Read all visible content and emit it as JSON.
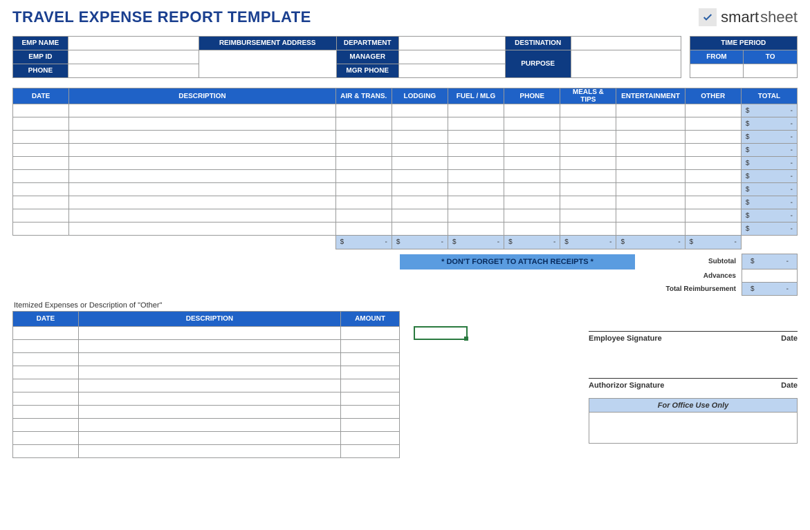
{
  "title": "TRAVEL EXPENSE REPORT TEMPLATE",
  "brand": {
    "name1": "smart",
    "name2": "sheet"
  },
  "info": {
    "emp_name_label": "EMP NAME",
    "emp_id_label": "EMP ID",
    "phone_label": "PHONE",
    "reimb_label": "REIMBURSEMENT ADDRESS",
    "dept_label": "DEPARTMENT",
    "mgr_label": "MANAGER",
    "mgrphone_label": "MGR PHONE",
    "dest_label": "DESTINATION",
    "purpose_label": "PURPOSE",
    "period_label": "TIME PERIOD",
    "from_label": "FROM",
    "to_label": "TO",
    "emp_name": "",
    "emp_id": "",
    "phone": "",
    "reimb": "",
    "dept": "",
    "mgr": "",
    "mgrphone": "",
    "dest": "",
    "purpose": "",
    "from": "",
    "to": ""
  },
  "expense_headers": {
    "date": "DATE",
    "desc": "DESCRIPTION",
    "air": "AIR & TRANS.",
    "lodg": "LODGING",
    "fuel": "FUEL / MLG",
    "ph": "PHONE",
    "meals": "MEALS & TIPS",
    "ent": "ENTERTAINMENT",
    "other": "OTHER",
    "total": "TOTAL"
  },
  "expense_rows": [
    {
      "date": "",
      "desc": "",
      "air": "",
      "lodg": "",
      "fuel": "",
      "ph": "",
      "meals": "",
      "ent": "",
      "other": "",
      "total_d": "$",
      "total_v": "-"
    },
    {
      "date": "",
      "desc": "",
      "air": "",
      "lodg": "",
      "fuel": "",
      "ph": "",
      "meals": "",
      "ent": "",
      "other": "",
      "total_d": "$",
      "total_v": "-"
    },
    {
      "date": "",
      "desc": "",
      "air": "",
      "lodg": "",
      "fuel": "",
      "ph": "",
      "meals": "",
      "ent": "",
      "other": "",
      "total_d": "$",
      "total_v": "-"
    },
    {
      "date": "",
      "desc": "",
      "air": "",
      "lodg": "",
      "fuel": "",
      "ph": "",
      "meals": "",
      "ent": "",
      "other": "",
      "total_d": "$",
      "total_v": "-"
    },
    {
      "date": "",
      "desc": "",
      "air": "",
      "lodg": "",
      "fuel": "",
      "ph": "",
      "meals": "",
      "ent": "",
      "other": "",
      "total_d": "$",
      "total_v": "-"
    },
    {
      "date": "",
      "desc": "",
      "air": "",
      "lodg": "",
      "fuel": "",
      "ph": "",
      "meals": "",
      "ent": "",
      "other": "",
      "total_d": "$",
      "total_v": "-"
    },
    {
      "date": "",
      "desc": "",
      "air": "",
      "lodg": "",
      "fuel": "",
      "ph": "",
      "meals": "",
      "ent": "",
      "other": "",
      "total_d": "$",
      "total_v": "-"
    },
    {
      "date": "",
      "desc": "",
      "air": "",
      "lodg": "",
      "fuel": "",
      "ph": "",
      "meals": "",
      "ent": "",
      "other": "",
      "total_d": "$",
      "total_v": "-"
    },
    {
      "date": "",
      "desc": "",
      "air": "",
      "lodg": "",
      "fuel": "",
      "ph": "",
      "meals": "",
      "ent": "",
      "other": "",
      "total_d": "$",
      "total_v": "-"
    },
    {
      "date": "",
      "desc": "",
      "air": "",
      "lodg": "",
      "fuel": "",
      "ph": "",
      "meals": "",
      "ent": "",
      "other": "",
      "total_d": "$",
      "total_v": "-"
    }
  ],
  "col_totals": {
    "air_d": "$",
    "air_v": "-",
    "lodg_d": "$",
    "lodg_v": "-",
    "fuel_d": "$",
    "fuel_v": "-",
    "ph_d": "$",
    "ph_v": "-",
    "meals_d": "$",
    "meals_v": "-",
    "ent_d": "$",
    "ent_v": "-",
    "other_d": "$",
    "other_v": "-"
  },
  "receipts_note": "* DON'T FORGET TO ATTACH RECEIPTS *",
  "summary": {
    "subtotal_label": "Subtotal",
    "subtotal_d": "$",
    "subtotal_v": "-",
    "advances_label": "Advances",
    "advances_v": "",
    "totalreimb_label": "Total Reimbursement",
    "totalreimb_d": "$",
    "totalreimb_v": "-"
  },
  "itemized_title": "Itemized Expenses or Description of \"Other\"",
  "itemized_headers": {
    "date": "DATE",
    "desc": "DESCRIPTION",
    "amount": "AMOUNT"
  },
  "itemized_rows": [
    {
      "date": "",
      "desc": "",
      "amount": ""
    },
    {
      "date": "",
      "desc": "",
      "amount": ""
    },
    {
      "date": "",
      "desc": "",
      "amount": ""
    },
    {
      "date": "",
      "desc": "",
      "amount": ""
    },
    {
      "date": "",
      "desc": "",
      "amount": ""
    },
    {
      "date": "",
      "desc": "",
      "amount": ""
    },
    {
      "date": "",
      "desc": "",
      "amount": ""
    },
    {
      "date": "",
      "desc": "",
      "amount": ""
    },
    {
      "date": "",
      "desc": "",
      "amount": ""
    },
    {
      "date": "",
      "desc": "",
      "amount": ""
    }
  ],
  "signatures": {
    "emp_label": "Employee Signature",
    "auth_label": "Authorizor Signature",
    "date_label": "Date"
  },
  "office_use": "For Office Use Only"
}
